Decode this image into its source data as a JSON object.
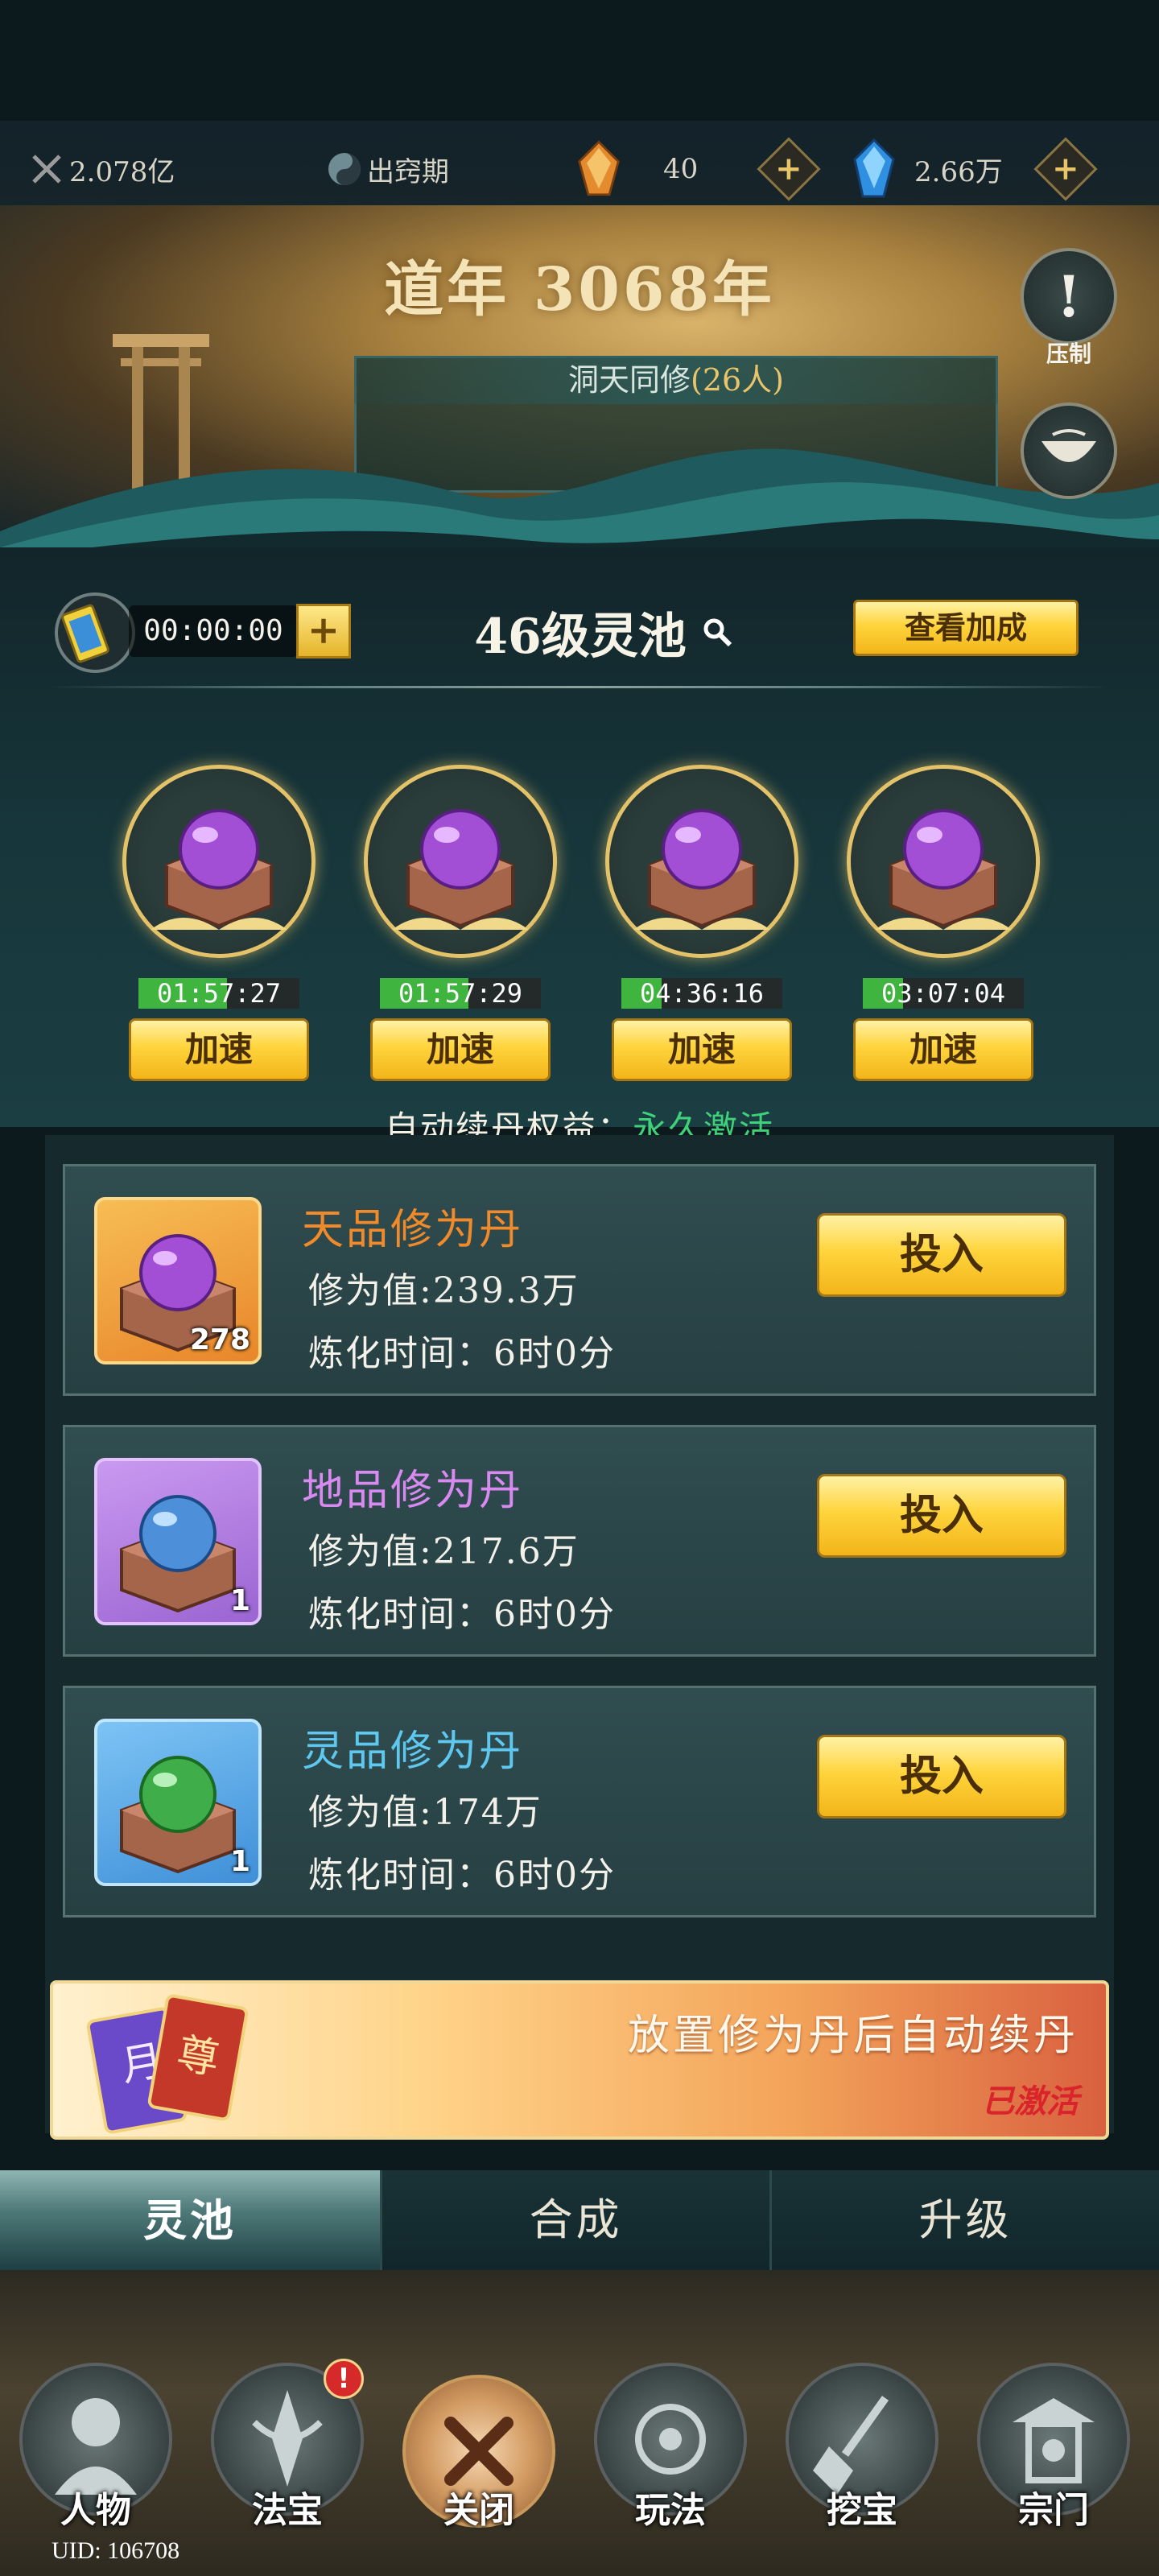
{
  "topbar": {
    "power": "2.078亿",
    "realm": "出窍期",
    "gems_a": "40",
    "gems_b": "2.66万"
  },
  "banner": {
    "year": "道年 3068年",
    "co_title": "洞天同修",
    "co_count": "(26人)",
    "side_label": "压制"
  },
  "pool": {
    "timer": "00:00:00",
    "timer_plus": "+",
    "title": "46级灵池",
    "view_button": "查看加成",
    "slots": [
      {
        "countdown": "01:57:27",
        "progress": 0.55,
        "button": "加速"
      },
      {
        "countdown": "01:57:29",
        "progress": 0.55,
        "button": "加速"
      },
      {
        "countdown": "04:36:16",
        "progress": 0.25,
        "button": "加速"
      },
      {
        "countdown": "03:07:04",
        "progress": 0.25,
        "button": "加速"
      }
    ],
    "auto_label": "自动续丹权益：",
    "auto_value": "永久激活"
  },
  "pills": [
    {
      "name": "天品修为丹",
      "value": "修为值:239.3万",
      "time": "炼化时间：6时0分",
      "qty": "278",
      "button": "投入",
      "name_color": "#f08a2a",
      "thumb": "#f2a13a",
      "orb": "#a24fd6"
    },
    {
      "name": "地品修为丹",
      "value": "修为值:217.6万",
      "time": "炼化时间：6时0分",
      "qty": "1",
      "button": "投入",
      "name_color": "#d88af0",
      "thumb": "#b47ee0",
      "orb": "#4d8fd8"
    },
    {
      "name": "灵品修为丹",
      "value": "修为值:174万",
      "time": "炼化时间：6时0分",
      "qty": "1",
      "button": "投入",
      "name_color": "#5ec8f0",
      "thumb": "#4f9fe0",
      "orb": "#3fae4a"
    }
  ],
  "renew": {
    "text": "放置修为丹后自动续丹",
    "status": "已激活",
    "card_a": "月",
    "card_b": "尊"
  },
  "tabs": [
    "灵池",
    "合成",
    "升级"
  ],
  "nav": {
    "items": [
      "人物",
      "法宝",
      "关闭",
      "玩法",
      "挖宝",
      "宗门"
    ],
    "badge": "!",
    "uid": "UID: 106708"
  }
}
